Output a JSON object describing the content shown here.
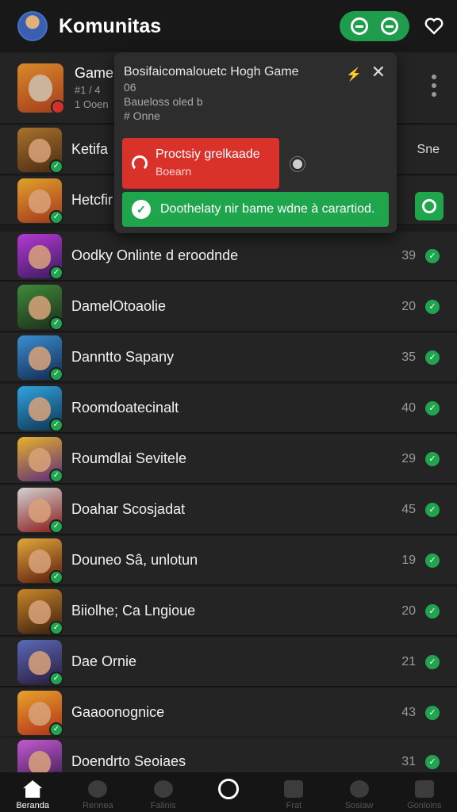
{
  "header": {
    "title": "Komunitas"
  },
  "top_item": {
    "title": "Game",
    "line2": "#1 / 4",
    "line3": "1 Ooen"
  },
  "popup": {
    "title": "Bosifaicomalouetc Hogh Game",
    "line1": "06",
    "line2": "Baueloss oled b",
    "line3": "# Onne",
    "red_label": "Proctsiy grelkaade",
    "red_sub": "Boearn",
    "green_text": "Doothelaty nir bame wdne à carartiod."
  },
  "partial_rows": [
    {
      "name": "Ketifa",
      "right": "Sne"
    },
    {
      "name": "Hetcfir"
    }
  ],
  "rows": [
    {
      "name": "Oodky Onlinte d eroodnde",
      "count": "39"
    },
    {
      "name": "DamelOtoaolie",
      "count": "20"
    },
    {
      "name": "Danntto Sapany",
      "count": "35"
    },
    {
      "name": "Roomdoatecinalt",
      "count": "40"
    },
    {
      "name": "Roumdlai Sevitele",
      "count": "29"
    },
    {
      "name": "Doahar Scosjadat",
      "count": "45"
    },
    {
      "name": "Douneo Sâ, unlotun",
      "count": "19"
    },
    {
      "name": "Biiolhe; Ca Lngioue",
      "count": "20"
    },
    {
      "name": "Dae Ornie",
      "count": "21"
    },
    {
      "name": "Gaaoonognice",
      "count": "43"
    },
    {
      "name": "Doendrto Seoiaes",
      "count": "31"
    }
  ],
  "nav": [
    {
      "label": "Beranda",
      "icon": "home-icon"
    },
    {
      "label": "Rennea",
      "icon": "search-icon"
    },
    {
      "label": "Falinis",
      "icon": "chat-icon"
    },
    {
      "label": "",
      "icon": "center-circle-icon"
    },
    {
      "label": "Frat",
      "icon": "chart-icon"
    },
    {
      "label": "Sosiaw",
      "icon": "game-icon"
    },
    {
      "label": "Gonloins",
      "icon": "profile-icon"
    }
  ],
  "colors": {
    "accent": "#1fa64d",
    "alert": "#d8322b",
    "bg": "#1c1c1c"
  }
}
